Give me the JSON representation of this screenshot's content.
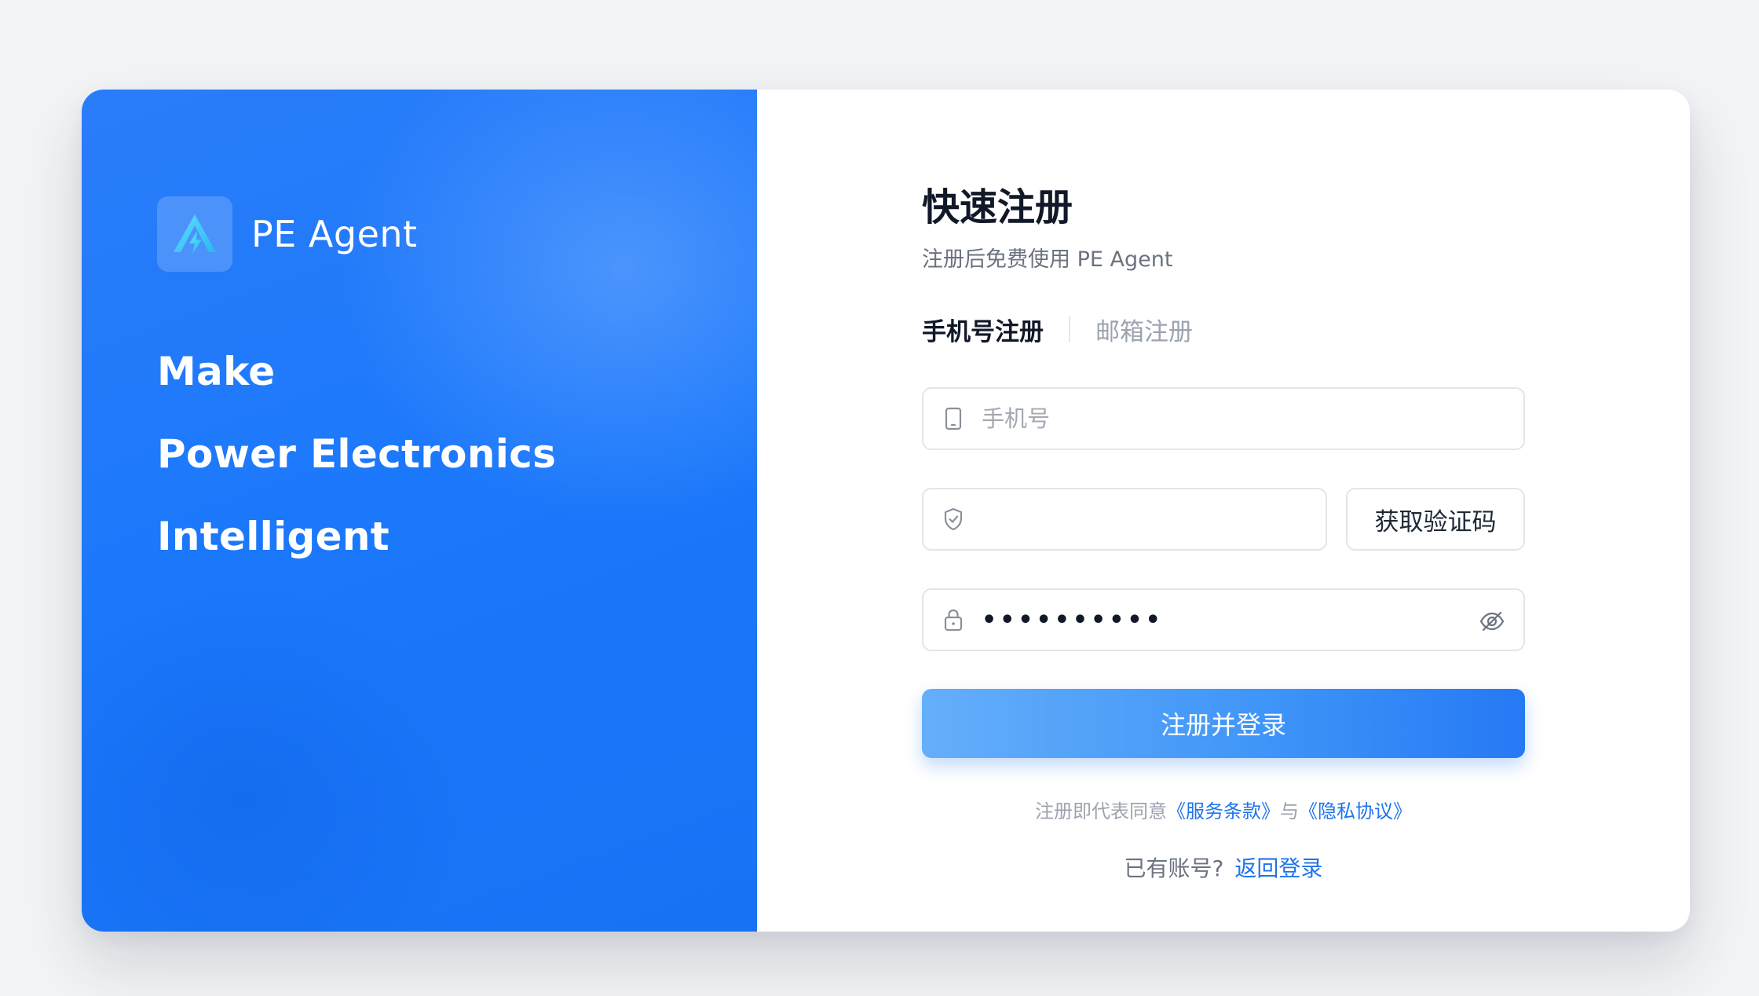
{
  "brand": {
    "name": "PE Agent",
    "logo_icon": "bolt-triangle-icon"
  },
  "taglines": [
    "Make",
    "Power Electronics",
    "Intelligent"
  ],
  "form": {
    "title": "快速注册",
    "subtitle": "注册后免费使用 PE Agent",
    "tabs": [
      {
        "label": "手机号注册",
        "active": true
      },
      {
        "label": "邮箱注册",
        "active": false
      }
    ],
    "phone": {
      "placeholder": "手机号",
      "value": "",
      "icon": "mobile-phone-icon"
    },
    "code": {
      "placeholder": "",
      "value": "",
      "icon": "shield-check-icon",
      "button_label": "获取验证码"
    },
    "password": {
      "masked_value": "••••••••••",
      "icon": "lock-icon",
      "toggle_icon": "eye-off-icon"
    },
    "submit_label": "注册并登录",
    "terms": {
      "prefix": "注册即代表同意",
      "service_link": "《服务条款》",
      "conjunction": "与",
      "privacy_link": "《隐私协议》"
    },
    "login_prompt": "已有账号?",
    "login_link": "返回登录"
  },
  "colors": {
    "primary": "#1b78fb",
    "link": "#1f74ec",
    "title": "#111827",
    "muted": "#9ca3af"
  }
}
